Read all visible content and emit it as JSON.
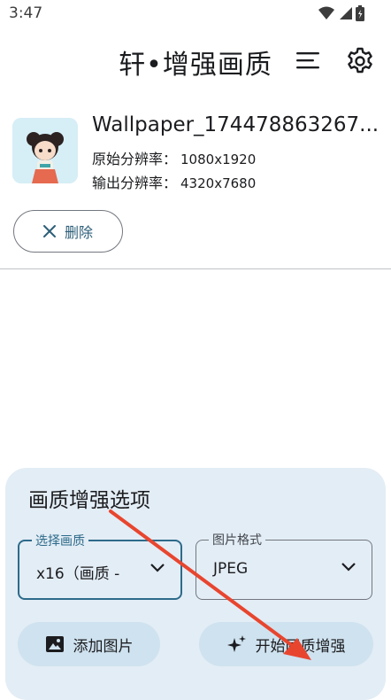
{
  "status_bar": {
    "time": "3:47"
  },
  "header": {
    "title": "轩•增强画质"
  },
  "image_item": {
    "filename": "Wallpaper_1744788632​67...",
    "original_label": "原始分辨率：",
    "original_value": "1080x1920",
    "output_label": "输出分辨率：",
    "output_value": "4320x7680"
  },
  "delete_button": {
    "label": "删除"
  },
  "options": {
    "title": "画质增强选项",
    "quality": {
      "label": "选择画质",
      "value": "x16（画质 -"
    },
    "format": {
      "label": "图片格式",
      "value": "JPEG"
    },
    "add_label": "添加图片",
    "start_label": "开始画质增强"
  },
  "colors": {
    "accent": "#2d6a8a",
    "panel": "#e3edf5",
    "tonal": "#cfe2ef",
    "annotation": "#e8452f"
  }
}
